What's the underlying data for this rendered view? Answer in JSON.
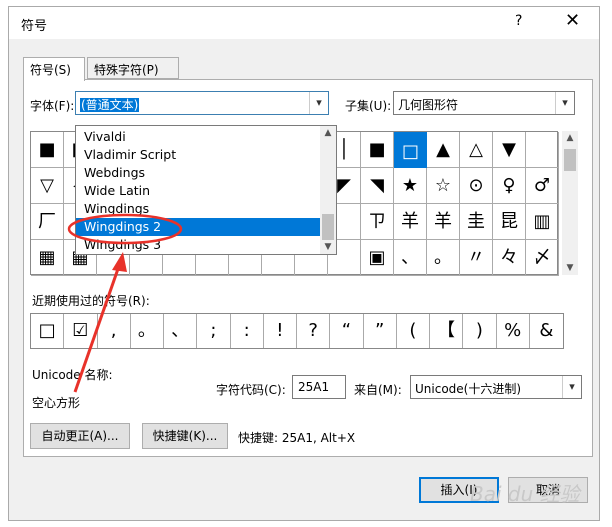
{
  "dialog": {
    "title": "符号",
    "help_label": "?",
    "close_label": "✕"
  },
  "tabs": [
    {
      "label": "符号(S)"
    },
    {
      "label": "特殊字符(P)"
    }
  ],
  "font": {
    "label": "字体(F):",
    "value": "(普通文本)"
  },
  "subset": {
    "label": "子集(U):",
    "value": "几何图形符"
  },
  "font_dropdown": {
    "items": [
      "Vivaldi",
      "Vladimir Script",
      "Webdings",
      "Wide Latin",
      "Wingdings",
      "Wingdings 2",
      "Wingdings 3"
    ],
    "selected": "Wingdings 2"
  },
  "symbol_grid": {
    "rows": [
      [
        "■",
        "■",
        "",
        "",
        "",
        "",
        "",
        "",
        "",
        "│",
        "■",
        "□",
        "▲",
        "△",
        "▼"
      ],
      [
        "▽",
        "◀",
        "",
        "",
        "",
        "",
        "",
        "",
        "",
        "◤",
        "◥",
        "★",
        "☆",
        "⊙",
        "♀",
        "♂"
      ],
      [
        "厂",
        "",
        "",
        "",
        "",
        "",
        "",
        "",
        "",
        "",
        "ㄗ",
        "羊",
        "羊",
        "圭",
        "昆",
        "▥",
        "▤"
      ],
      [
        "▦",
        "▦",
        "",
        "",
        "",
        "",
        "",
        "",
        "",
        "",
        "▣",
        "、",
        "。",
        "〃",
        "々",
        "〆"
      ]
    ],
    "selected_symbol": "□"
  },
  "recent": {
    "label": "近期使用过的符号(R):",
    "symbols": [
      "□",
      "☑",
      ",",
      "。",
      "、",
      ";",
      ":",
      "!",
      "?",
      "“",
      "”",
      "(",
      "【",
      ")",
      "%",
      "&"
    ]
  },
  "unicode_name_label": "Unicode 名称:",
  "unicode_name_value": "空心方形",
  "char_code": {
    "label": "字符代码(C):",
    "value": "25A1"
  },
  "from": {
    "label": "来自(M):",
    "value": "Unicode(十六进制)"
  },
  "buttons": {
    "autocorrect": "自动更正(A)...",
    "shortcut_key": "快捷键(K)...",
    "insert": "插入(I)",
    "cancel": "取消"
  },
  "shortcut_text": "快捷键: 25A1, Alt+X",
  "watermark": "Bai du 经验",
  "colors": {
    "accent": "#0078d7",
    "annotation": "#e8322a"
  }
}
